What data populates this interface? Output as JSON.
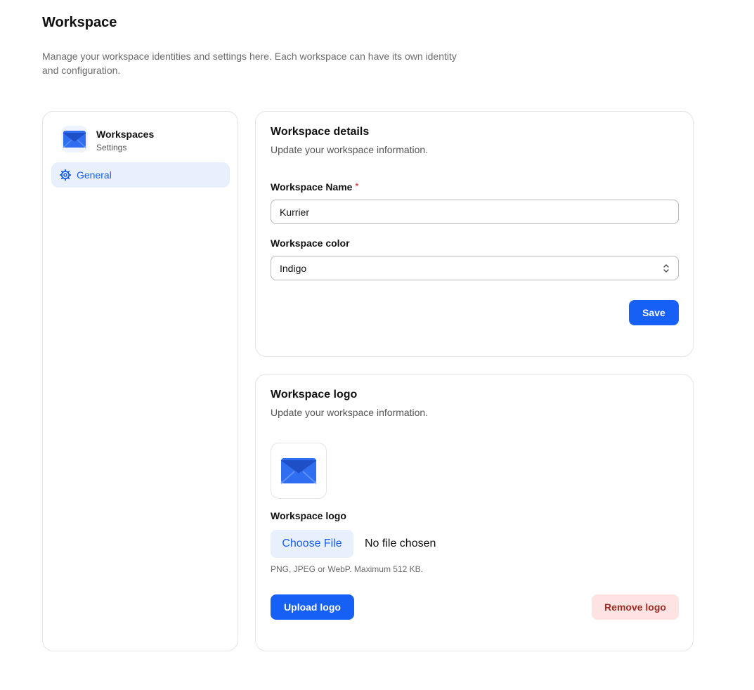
{
  "page": {
    "title": "Workspace",
    "description": "Manage your workspace identities and settings here. Each workspace can have its own identity and configuration."
  },
  "sidebar": {
    "title": "Workspaces",
    "subtitle": "Settings",
    "items": [
      {
        "label": "General",
        "icon": "gear-icon",
        "active": true
      }
    ]
  },
  "details": {
    "title": "Workspace details",
    "subtitle": "Update your workspace information.",
    "name_label": "Workspace Name",
    "required_mark": "*",
    "name_value": "Kurrier",
    "color_label": "Workspace color",
    "color_value": "Indigo",
    "save_label": "Save"
  },
  "logo": {
    "title": "Workspace logo",
    "subtitle": "Update your workspace information.",
    "field_label": "Workspace logo",
    "choose_file_label": "Choose File",
    "no_file_text": "No file chosen",
    "hint": "PNG, JPEG or WebP. Maximum 512 KB.",
    "upload_label": "Upload logo",
    "remove_label": "Remove logo"
  },
  "colors": {
    "accent": "#1660f5",
    "accent_soft": "#e8effd",
    "danger_text": "#9b2c25",
    "danger_bg": "#fde4e2",
    "border": "#e4e4e7"
  }
}
